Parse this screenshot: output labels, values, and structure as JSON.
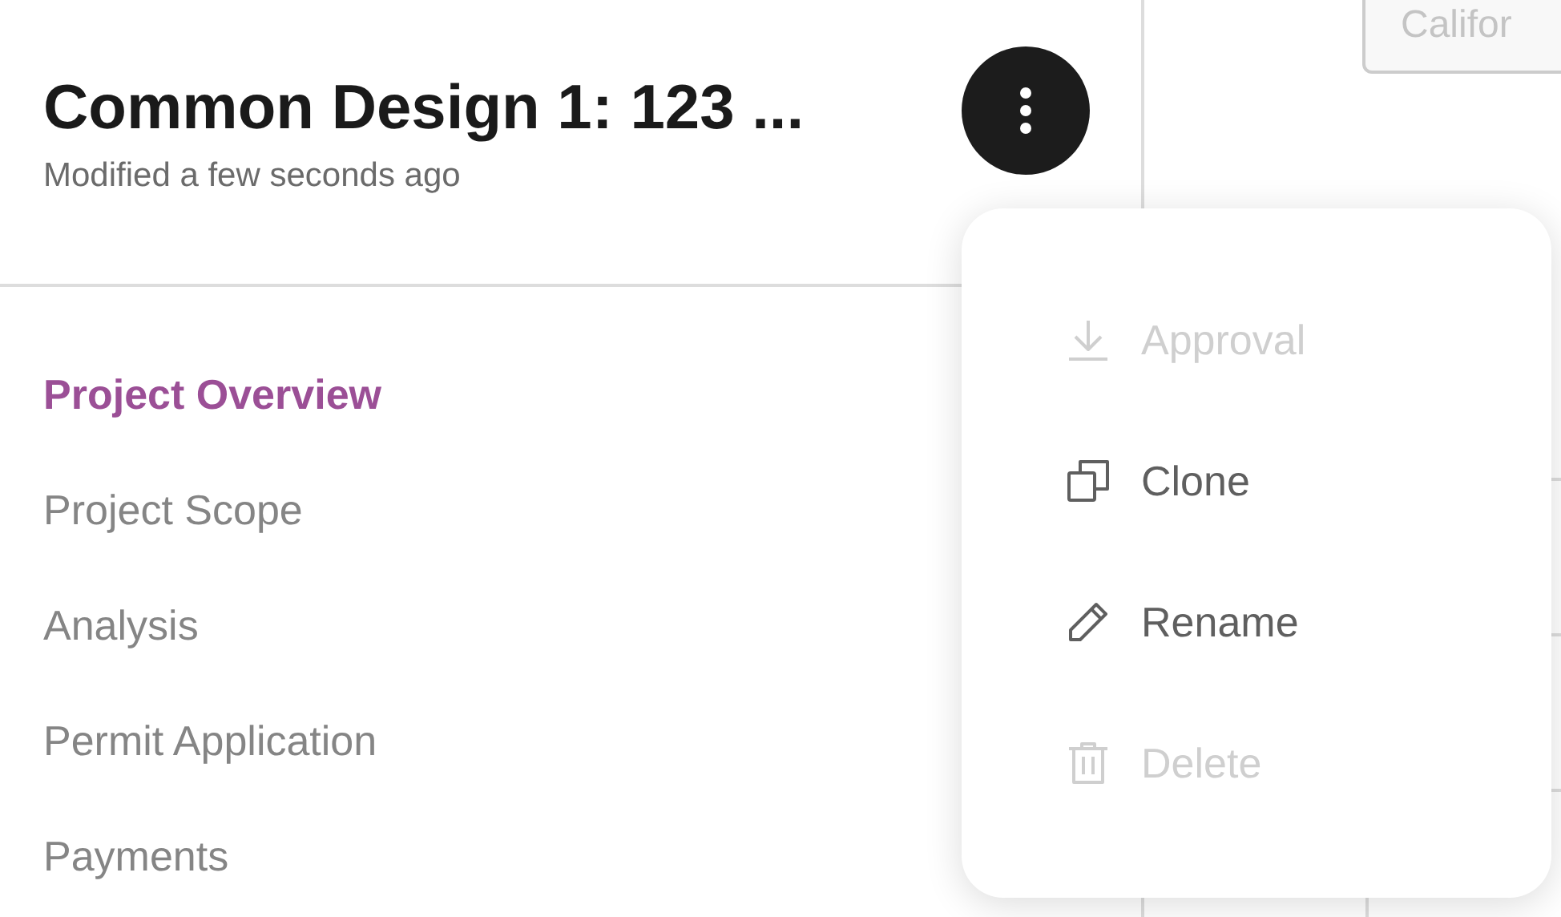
{
  "header": {
    "title": "Common Design 1: 123 ...",
    "subtitle": "Modified a few seconds ago"
  },
  "nav": [
    {
      "label": "Project Overview",
      "selected": true
    },
    {
      "label": "Project Scope",
      "selected": false
    },
    {
      "label": "Analysis",
      "selected": false
    },
    {
      "label": "Permit Application",
      "selected": false
    },
    {
      "label": "Payments",
      "selected": false
    }
  ],
  "field": {
    "value": "Califor"
  },
  "menu": [
    {
      "kind": "download",
      "label": "Approval",
      "disabled": true
    },
    {
      "kind": "copy",
      "label": "Clone",
      "disabled": false
    },
    {
      "kind": "edit",
      "label": "Rename",
      "disabled": false
    },
    {
      "kind": "delete",
      "label": "Delete",
      "disabled": true
    }
  ]
}
